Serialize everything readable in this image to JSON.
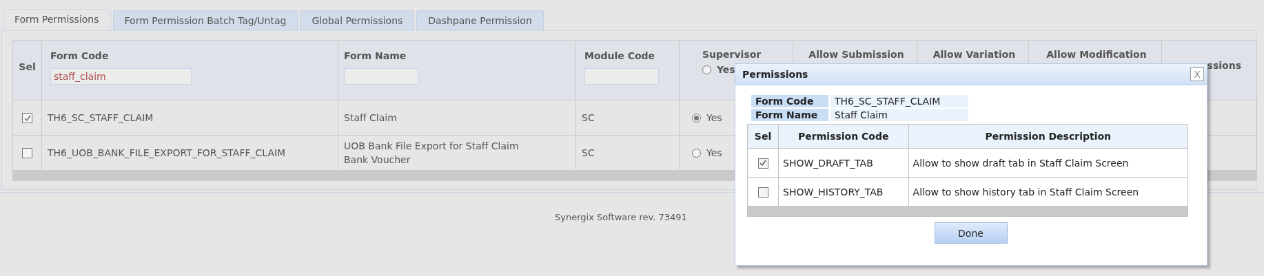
{
  "tabs": [
    {
      "label": "Form Permissions",
      "selected": true
    },
    {
      "label": "Form Permission Batch Tag/Untag",
      "selected": false
    },
    {
      "label": "Global Permissions",
      "selected": false
    },
    {
      "label": "Dashpane Permission",
      "selected": false
    }
  ],
  "table": {
    "columns": [
      {
        "label": "Sel",
        "kind": "plain"
      },
      {
        "label": "Form Code",
        "kind": "filter",
        "value": "staff_claim"
      },
      {
        "label": "Form Name",
        "kind": "filter"
      },
      {
        "label": "Module Code",
        "kind": "filter"
      },
      {
        "label": "Supervisor",
        "kind": "radio",
        "option": "Yes",
        "selected": false
      },
      {
        "label": "Allow Submission",
        "kind": "plain"
      },
      {
        "label": "Allow Variation",
        "kind": "plain"
      },
      {
        "label": "Allow Modification",
        "kind": "plain"
      },
      {
        "label": "ssions",
        "kind": "plain"
      }
    ],
    "rows": [
      {
        "selected": true,
        "form_code": "TH6_SC_STAFF_CLAIM",
        "form_name": "Staff Claim",
        "module_code": "SC",
        "supervisor": {
          "label": "Yes",
          "selected": true
        }
      },
      {
        "selected": false,
        "form_code": "TH6_UOB_BANK_FILE_EXPORT_FOR_STAFF_CLAIM",
        "form_name": "UOB Bank File Export for Staff Claim Bank Voucher",
        "module_code": "SC",
        "supervisor": {
          "label": "Yes",
          "selected": false
        }
      }
    ]
  },
  "dialog": {
    "title": "Permissions",
    "close": "X",
    "fields": [
      {
        "label": "Form Code",
        "value": "TH6_SC_STAFF_CLAIM"
      },
      {
        "label": "Form Name",
        "value": "Staff Claim"
      }
    ],
    "columns": [
      "Sel",
      "Permission Code",
      "Permission Description"
    ],
    "rows": [
      {
        "checked": true,
        "code": "SHOW_DRAFT_TAB",
        "description": "Allow to show draft tab in Staff Claim Screen"
      },
      {
        "checked": false,
        "code": "SHOW_HISTORY_TAB",
        "description": "Allow to show history tab in Staff Claim Screen"
      }
    ],
    "button": "Done"
  },
  "footer": "Synergix Software rev. 73491"
}
